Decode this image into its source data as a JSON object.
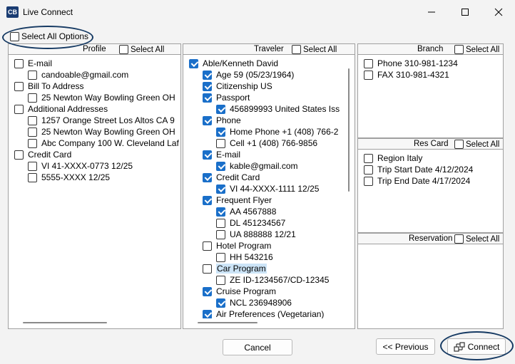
{
  "window": {
    "app_icon": "CB",
    "title": "Live Connect"
  },
  "select_all_options": {
    "label": "Select All Options",
    "checked": false
  },
  "profile": {
    "title": "Profile",
    "select_all": "Select All",
    "items": [
      {
        "label": "E-mail",
        "level": 0,
        "checked": false
      },
      {
        "label": "candoable@gmail.com",
        "level": 1,
        "checked": false
      },
      {
        "label": "Bill To Address",
        "level": 0,
        "checked": false
      },
      {
        "label": "25 Newton Way Bowling Green OH",
        "level": 1,
        "checked": false
      },
      {
        "label": "Additional Addresses",
        "level": 0,
        "checked": false
      },
      {
        "label": "1257 Orange Street Los Altos CA 9",
        "level": 1,
        "checked": false
      },
      {
        "label": "25 Newton Way Bowling Green OH",
        "level": 1,
        "checked": false
      },
      {
        "label": "Abc Company 100 W. Cleveland Laf",
        "level": 1,
        "checked": false
      },
      {
        "label": "Credit Card",
        "level": 0,
        "checked": false
      },
      {
        "label": "VI 41-XXXX-0773 12/25",
        "level": 1,
        "checked": false
      },
      {
        "label": "5555-XXXX 12/25",
        "level": 1,
        "checked": false
      }
    ]
  },
  "traveler": {
    "title": "Traveler",
    "select_all": "Select All",
    "items": [
      {
        "label": "Able/Kenneth David",
        "level": 0,
        "checked": true
      },
      {
        "label": "Age 59 (05/23/1964)",
        "level": 1,
        "checked": true
      },
      {
        "label": "Citizenship US",
        "level": 1,
        "checked": true
      },
      {
        "label": "Passport",
        "level": 1,
        "checked": true
      },
      {
        "label": "456899993 United States Iss",
        "level": 2,
        "checked": true
      },
      {
        "label": "Phone",
        "level": 1,
        "checked": true
      },
      {
        "label": "Home Phone +1 (408) 766-2",
        "level": 2,
        "checked": true
      },
      {
        "label": "Cell +1 (408) 766-9856",
        "level": 2,
        "checked": false
      },
      {
        "label": "E-mail",
        "level": 1,
        "checked": true
      },
      {
        "label": "kable@gmail.com",
        "level": 2,
        "checked": true
      },
      {
        "label": "Credit Card",
        "level": 1,
        "checked": true
      },
      {
        "label": "VI 44-XXXX-1111 12/25",
        "level": 2,
        "checked": true
      },
      {
        "label": "Frequent Flyer",
        "level": 1,
        "checked": true
      },
      {
        "label": "AA 4567888",
        "level": 2,
        "checked": true
      },
      {
        "label": "DL 451234567",
        "level": 2,
        "checked": false
      },
      {
        "label": "UA 888888 12/21",
        "level": 2,
        "checked": false
      },
      {
        "label": "Hotel Program",
        "level": 1,
        "checked": false
      },
      {
        "label": "HH 543216",
        "level": 2,
        "checked": false
      },
      {
        "label": "Car Program",
        "level": 1,
        "checked": false,
        "selected": true
      },
      {
        "label": "ZE ID-1234567/CD-12345",
        "level": 2,
        "checked": false
      },
      {
        "label": "Cruise Program",
        "level": 1,
        "checked": true
      },
      {
        "label": "NCL 236948906",
        "level": 2,
        "checked": true
      },
      {
        "label": "Air Preferences (Vegetarian)",
        "level": 1,
        "checked": true
      }
    ]
  },
  "branch": {
    "title": "Branch",
    "select_all": "Select All",
    "items": [
      {
        "label": "Phone 310-981-1234",
        "level": 0,
        "checked": false
      },
      {
        "label": "FAX 310-981-4321",
        "level": 0,
        "checked": false
      }
    ]
  },
  "res_card": {
    "title": "Res Card",
    "select_all": "Select All",
    "items": [
      {
        "label": "Region Italy",
        "level": 0,
        "checked": false
      },
      {
        "label": "Trip Start Date 4/12/2024",
        "level": 0,
        "checked": false
      },
      {
        "label": "Trip End Date 4/17/2024",
        "level": 0,
        "checked": false
      }
    ]
  },
  "reservation": {
    "title": "Reservation",
    "select_all": "Select All",
    "items": []
  },
  "buttons": {
    "cancel": "Cancel",
    "previous": "<< Previous",
    "connect": "Connect"
  },
  "icons": [
    "app-icon",
    "minimize-icon",
    "maximize-icon",
    "close-icon",
    "connect-icon"
  ]
}
